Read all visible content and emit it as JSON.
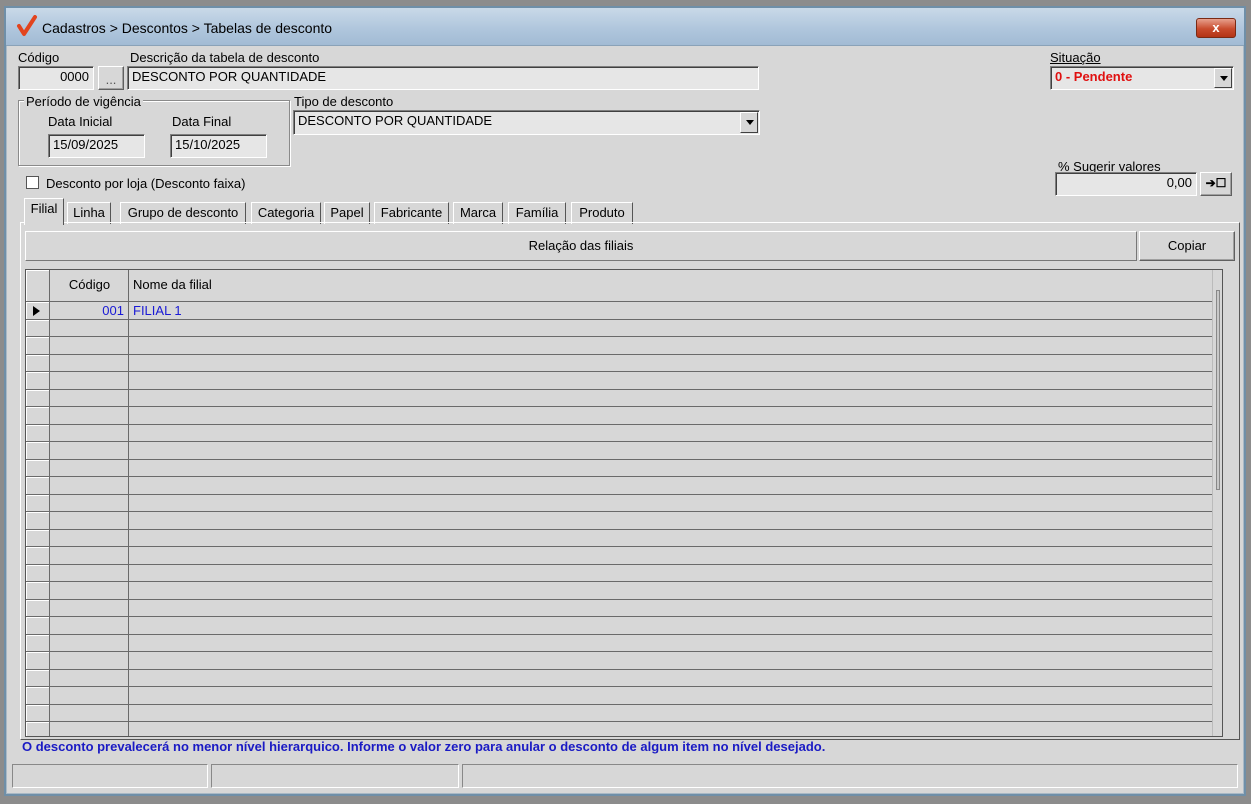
{
  "window": {
    "title": "Cadastros > Descontos > Tabelas de desconto",
    "close_label": "x"
  },
  "form": {
    "codigo_label": "Código",
    "codigo_value": "0000",
    "lookup_label": "...",
    "descricao_label": "Descrição da tabela de desconto",
    "descricao_value": "DESCONTO POR QUANTIDADE",
    "situacao_label": "Situação",
    "situacao_value": "0 - Pendente",
    "periodo_label": "Período de vigência",
    "data_inicial_label": "Data Inicial",
    "data_inicial_value": "15/09/2025",
    "data_final_label": "Data Final",
    "data_final_value": "15/10/2025",
    "tipo_label": "Tipo de desconto",
    "tipo_value": "DESCONTO POR QUANTIDADE",
    "desconto_loja_label": "Desconto por loja (Desconto faixa)",
    "sugerir_label": "% Sugerir valores",
    "sugerir_value": "0,00",
    "apply_icon_label": "➔☐"
  },
  "tabs": [
    {
      "label": "Filial"
    },
    {
      "label": "Linha"
    },
    {
      "label": "Grupo de desconto"
    },
    {
      "label": "Categoria"
    },
    {
      "label": "Papel"
    },
    {
      "label": "Fabricante"
    },
    {
      "label": "Marca"
    },
    {
      "label": "Família"
    },
    {
      "label": "Produto"
    }
  ],
  "panel": {
    "header": "Relação das filiais",
    "copy_label": "Copiar",
    "columns": {
      "code": "Código",
      "name": "Nome da filial"
    },
    "rows": [
      {
        "code": "001",
        "name": "FILIAL 1"
      }
    ]
  },
  "footer_note": "O desconto prevalecerá no menor nível hierarquico. Informe o valor zero para anular o desconto de algum item no nível desejado.",
  "colors": {
    "situacao_text": "#e01010",
    "grid_text": "#1a1ad6",
    "footer_text": "#1a1ac4",
    "title_check": "#e2441e"
  }
}
